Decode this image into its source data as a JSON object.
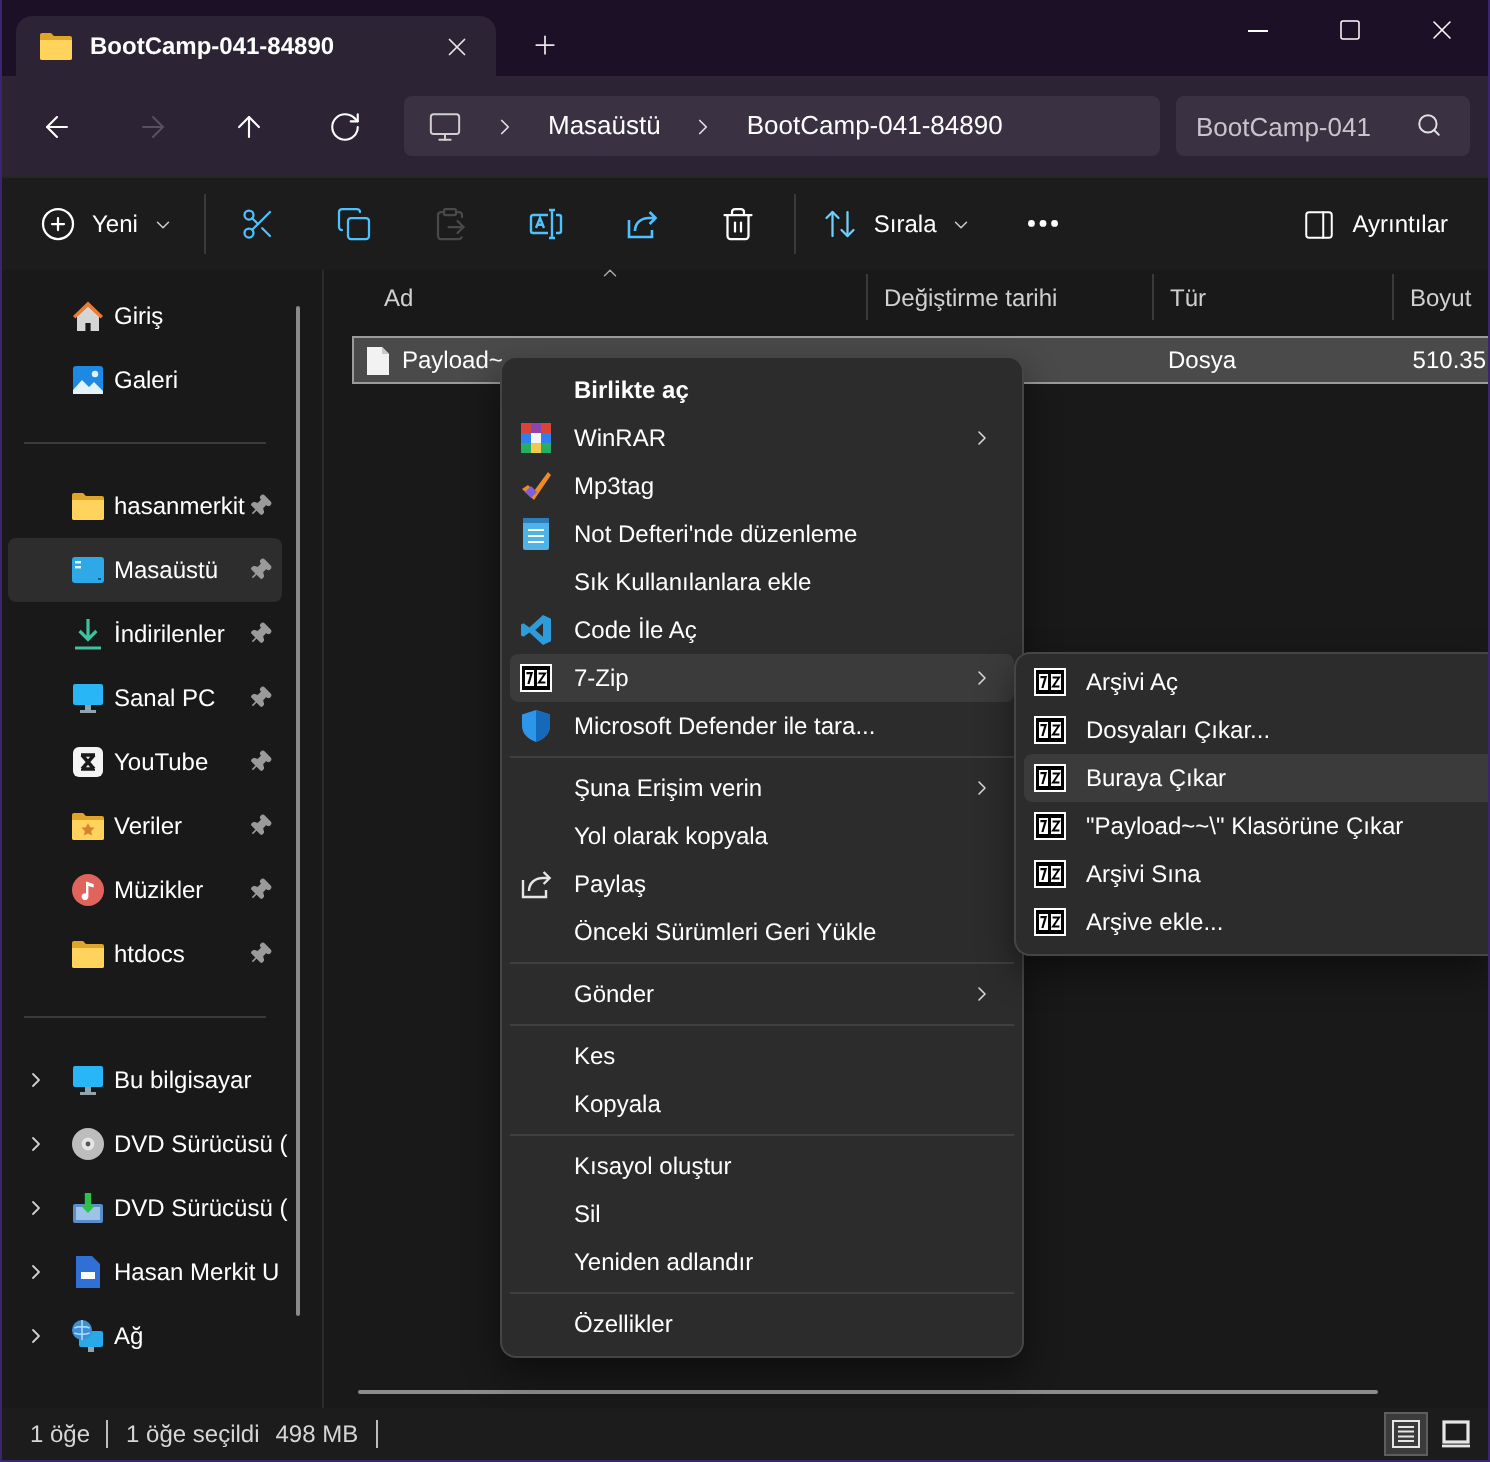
{
  "tabs": [
    {
      "title": "BootCamp-041-84890",
      "selected": true
    }
  ],
  "navigation": [
    {
      "kind": "back",
      "disabled": false
    },
    {
      "kind": "forward",
      "disabled": true
    },
    {
      "kind": "up",
      "disabled": false
    },
    {
      "kind": "refresh",
      "disabled": false
    }
  ],
  "address_bar": {
    "segments": [
      "Masaüstü",
      "BootCamp-041-84890"
    ]
  },
  "search": {
    "placeholder": "BootCamp-041"
  },
  "toolbar": {
    "items": [
      {
        "kind": "new",
        "label": "Yeni",
        "disabled": false
      },
      {
        "kind": "separator"
      },
      {
        "kind": "cut",
        "disabled": false
      },
      {
        "kind": "copy",
        "disabled": false
      },
      {
        "kind": "paste",
        "disabled": true
      },
      {
        "kind": "rename",
        "disabled": false
      },
      {
        "kind": "share",
        "disabled": false
      },
      {
        "kind": "delete",
        "disabled": false
      },
      {
        "kind": "separator"
      },
      {
        "kind": "sort",
        "label": "Sırala",
        "disabled": false
      },
      {
        "kind": "more",
        "disabled": false
      }
    ],
    "details_button": {
      "label": "Ayrıntılar"
    }
  },
  "sidebar": {
    "sections": [
      {
        "items": [
          {
            "kind": "home",
            "label": "Giriş",
            "selected": false
          },
          {
            "kind": "gallery",
            "label": "Galeri",
            "selected": false
          }
        ]
      },
      {
        "items": [
          {
            "kind": "folder",
            "label": "hasanmerkit",
            "pinned": true,
            "selected": false
          },
          {
            "kind": "desktop",
            "label": "Masaüstü",
            "pinned": true,
            "selected": true
          },
          {
            "kind": "downloads",
            "label": "İndirilenler",
            "pinned": true,
            "selected": false
          },
          {
            "kind": "computer",
            "label": "Sanal PC",
            "pinned": true,
            "selected": false
          },
          {
            "kind": "app",
            "label": "YouTube",
            "pinned": true,
            "selected": false
          },
          {
            "kind": "starred_folder",
            "label": "Veriler",
            "pinned": true,
            "selected": false
          },
          {
            "kind": "music",
            "label": "Müzikler",
            "pinned": true,
            "selected": false
          },
          {
            "kind": "folder",
            "label": "htdocs",
            "pinned": true,
            "selected": false
          }
        ]
      },
      {
        "items": [
          {
            "kind": "computer",
            "label": "Bu bilgisayar",
            "expanded": false,
            "selected": false
          },
          {
            "kind": "disc",
            "label": "DVD Sürücüsü (",
            "expanded": false,
            "selected": false
          },
          {
            "kind": "disc_setup",
            "label": "DVD Sürücüsü (",
            "expanded": false,
            "selected": false
          },
          {
            "kind": "usb",
            "label": "Hasan Merkit U",
            "expanded": false,
            "selected": false
          },
          {
            "kind": "network",
            "label": "Ağ",
            "expanded": false,
            "selected": false
          }
        ]
      }
    ]
  },
  "file_list": {
    "columns": [
      {
        "label": "Ad",
        "sorted": true
      },
      {
        "label": "Değiştirme tarihi",
        "sorted": false
      },
      {
        "label": "Tür",
        "sorted": false
      },
      {
        "label": "Boyut",
        "sorted": false
      }
    ],
    "rows": [
      {
        "name": "Payload~",
        "type": "Dosya",
        "size": "510.35",
        "selected": true
      }
    ]
  },
  "context_menu": {
    "items": [
      {
        "kind": "default",
        "label": "Birlikte aç",
        "submenu": false,
        "selected": false
      },
      {
        "kind": "books",
        "label": "WinRAR",
        "submenu": true,
        "selected": false
      },
      {
        "kind": "checkmark",
        "label": "Mp3tag",
        "submenu": false,
        "selected": false
      },
      {
        "kind": "notepad",
        "label": "Not Defteri'nde düzenleme",
        "submenu": false,
        "selected": false
      },
      {
        "kind": "plain",
        "label": "Sık Kullanılanlara ekle",
        "submenu": false,
        "selected": false
      },
      {
        "kind": "code",
        "label": "Code İle Aç",
        "submenu": false,
        "selected": false
      },
      {
        "kind": "archive",
        "label": "7-Zip",
        "submenu": true,
        "selected": true
      },
      {
        "kind": "shield",
        "label": "Microsoft Defender ile tara...",
        "submenu": false,
        "selected": false
      },
      {
        "kind": "separator"
      },
      {
        "kind": "plain",
        "label": "Şuna Erişim verin",
        "submenu": true,
        "selected": false
      },
      {
        "kind": "plain",
        "label": "Yol olarak kopyala",
        "submenu": false,
        "selected": false
      },
      {
        "kind": "share",
        "label": "Paylaş",
        "submenu": false,
        "selected": false
      },
      {
        "kind": "plain",
        "label": "Önceki Sürümleri Geri Yükle",
        "submenu": false,
        "selected": false
      },
      {
        "kind": "separator"
      },
      {
        "kind": "plain",
        "label": "Gönder",
        "submenu": true,
        "selected": false
      },
      {
        "kind": "separator"
      },
      {
        "kind": "plain",
        "label": "Kes",
        "submenu": false,
        "selected": false
      },
      {
        "kind": "plain",
        "label": "Kopyala",
        "submenu": false,
        "selected": false
      },
      {
        "kind": "separator"
      },
      {
        "kind": "plain",
        "label": "Kısayol oluştur",
        "submenu": false,
        "selected": false
      },
      {
        "kind": "plain",
        "label": "Sil",
        "submenu": false,
        "selected": false
      },
      {
        "kind": "plain",
        "label": "Yeniden adlandır",
        "submenu": false,
        "selected": false
      },
      {
        "kind": "separator"
      },
      {
        "kind": "plain",
        "label": "Özellikler",
        "submenu": false,
        "selected": false
      }
    ]
  },
  "submenu": {
    "items": [
      {
        "label": "Arşivi Aç",
        "selected": false
      },
      {
        "label": "Dosyaları Çıkar...",
        "selected": false
      },
      {
        "label": "Buraya Çıkar",
        "selected": true
      },
      {
        "label": "\"Payload~~\\\" Klasörüne Çıkar",
        "selected": false
      },
      {
        "label": "Arşivi Sına",
        "selected": false
      },
      {
        "label": "Arşive ekle...",
        "selected": false
      }
    ]
  },
  "status_bar": {
    "item_count": "1 öğe",
    "selection": "1 öğe seçildi",
    "selection_size": "498 MB",
    "views": [
      {
        "kind": "details",
        "selected": true
      },
      {
        "kind": "tiles",
        "selected": false
      }
    ]
  }
}
